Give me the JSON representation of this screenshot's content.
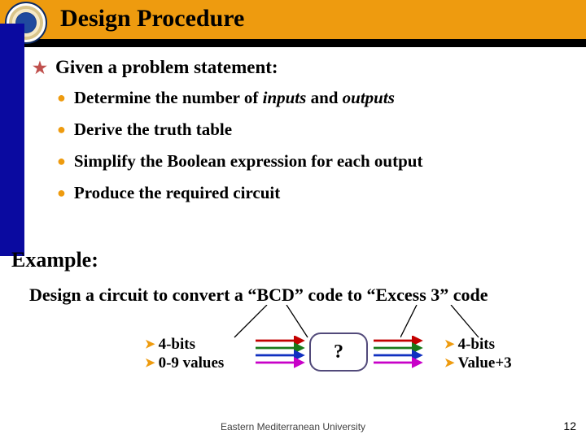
{
  "title": "Design Procedure",
  "main": {
    "heading": "Given a problem statement:",
    "bullets": [
      {
        "pre": "Determine the number of ",
        "em1": "inputs",
        "mid": " and ",
        "em2": "outputs"
      },
      {
        "text": "Derive the truth table"
      },
      {
        "text": "Simplify the Boolean expression for each output"
      },
      {
        "text": "Produce the required circuit"
      }
    ]
  },
  "example": {
    "label": "Example:",
    "text": "Design a circuit to convert a “BCD” code to “Excess 3” code"
  },
  "diagram": {
    "inputs": {
      "line1": "4-bits",
      "line2": "0-9 values"
    },
    "box": "?",
    "outputs": {
      "line1": "4-bits",
      "line2": "Value+3"
    }
  },
  "footer": "Eastern Mediterranean University",
  "page": "12"
}
